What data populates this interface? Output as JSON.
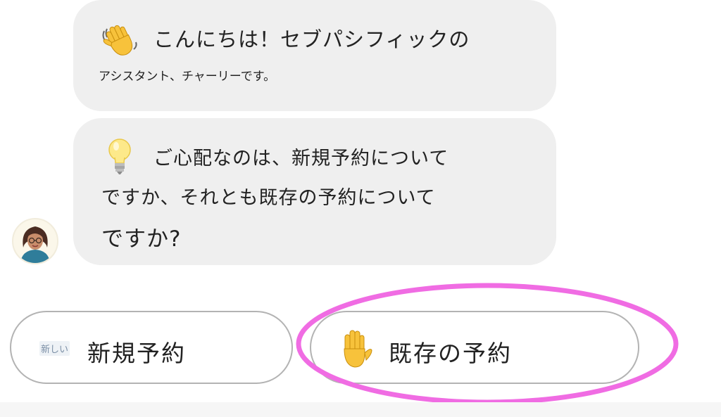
{
  "chat": {
    "greeting": {
      "icon": "waving-hand-icon",
      "line1": "こんにちは！セブパシフィックの",
      "line2": "アシスタント、チャーリーです。"
    },
    "question": {
      "icon": "light-bulb-icon",
      "line1": "ご心配なのは、新規予約について",
      "line2": "ですか、それとも既存の予約について",
      "line3": "ですか?"
    },
    "agent": {
      "avatar_icon": "assistant-avatar-icon"
    }
  },
  "options": [
    {
      "badge": "新しい",
      "label": "新規予約",
      "icon": "new-badge"
    },
    {
      "label": "既存の予約",
      "icon": "raised-hand-icon"
    }
  ],
  "annotation": {
    "highlight_color": "#f06ce3",
    "target": "existing-booking-button"
  },
  "colors": {
    "bubble": "#efefef",
    "button_border": "#b3b3b3",
    "text": "#222222"
  }
}
